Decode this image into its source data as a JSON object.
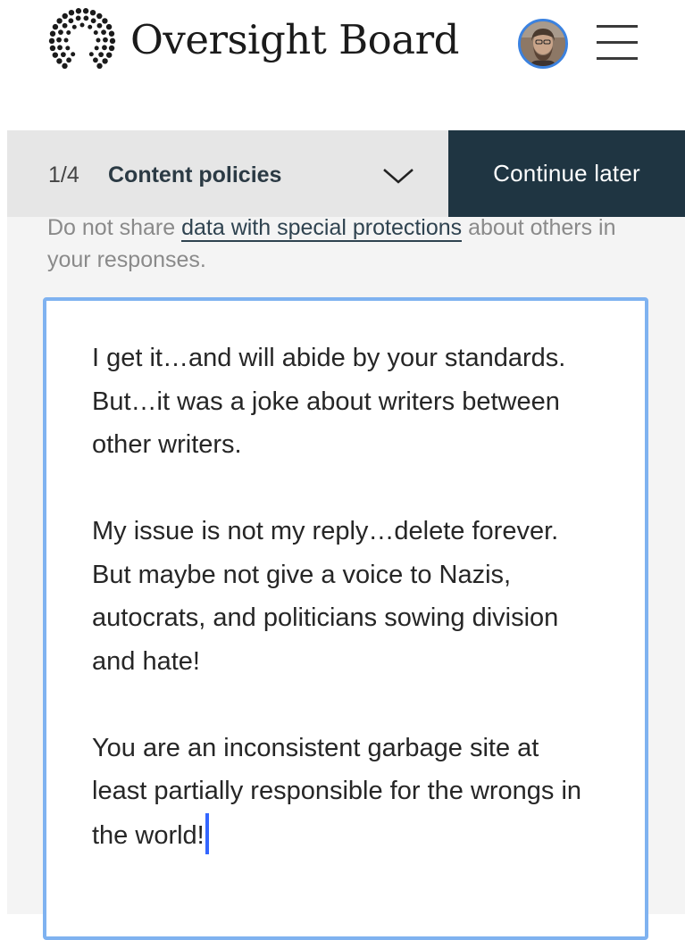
{
  "header": {
    "brand_name": "Oversight Board",
    "accent_color": "#3b82e0"
  },
  "step_bar": {
    "step_count": "1/4",
    "step_title": "Content policies",
    "continue_label": "Continue later"
  },
  "notice": {
    "prefix": "Do not share ",
    "link_text": "data with special protections",
    "suffix": " about others in your responses."
  },
  "response": {
    "paragraphs": [
      "I get it…and will abide by your standards. But…it was a joke about writers between other writers.",
      "My issue is not my reply…delete forever. But maybe not give a voice to Nazis, autocrats, and politicians sowing division and hate!",
      "You are an inconsistent garbage site at least partially responsible for the wrongs in the world!"
    ]
  }
}
